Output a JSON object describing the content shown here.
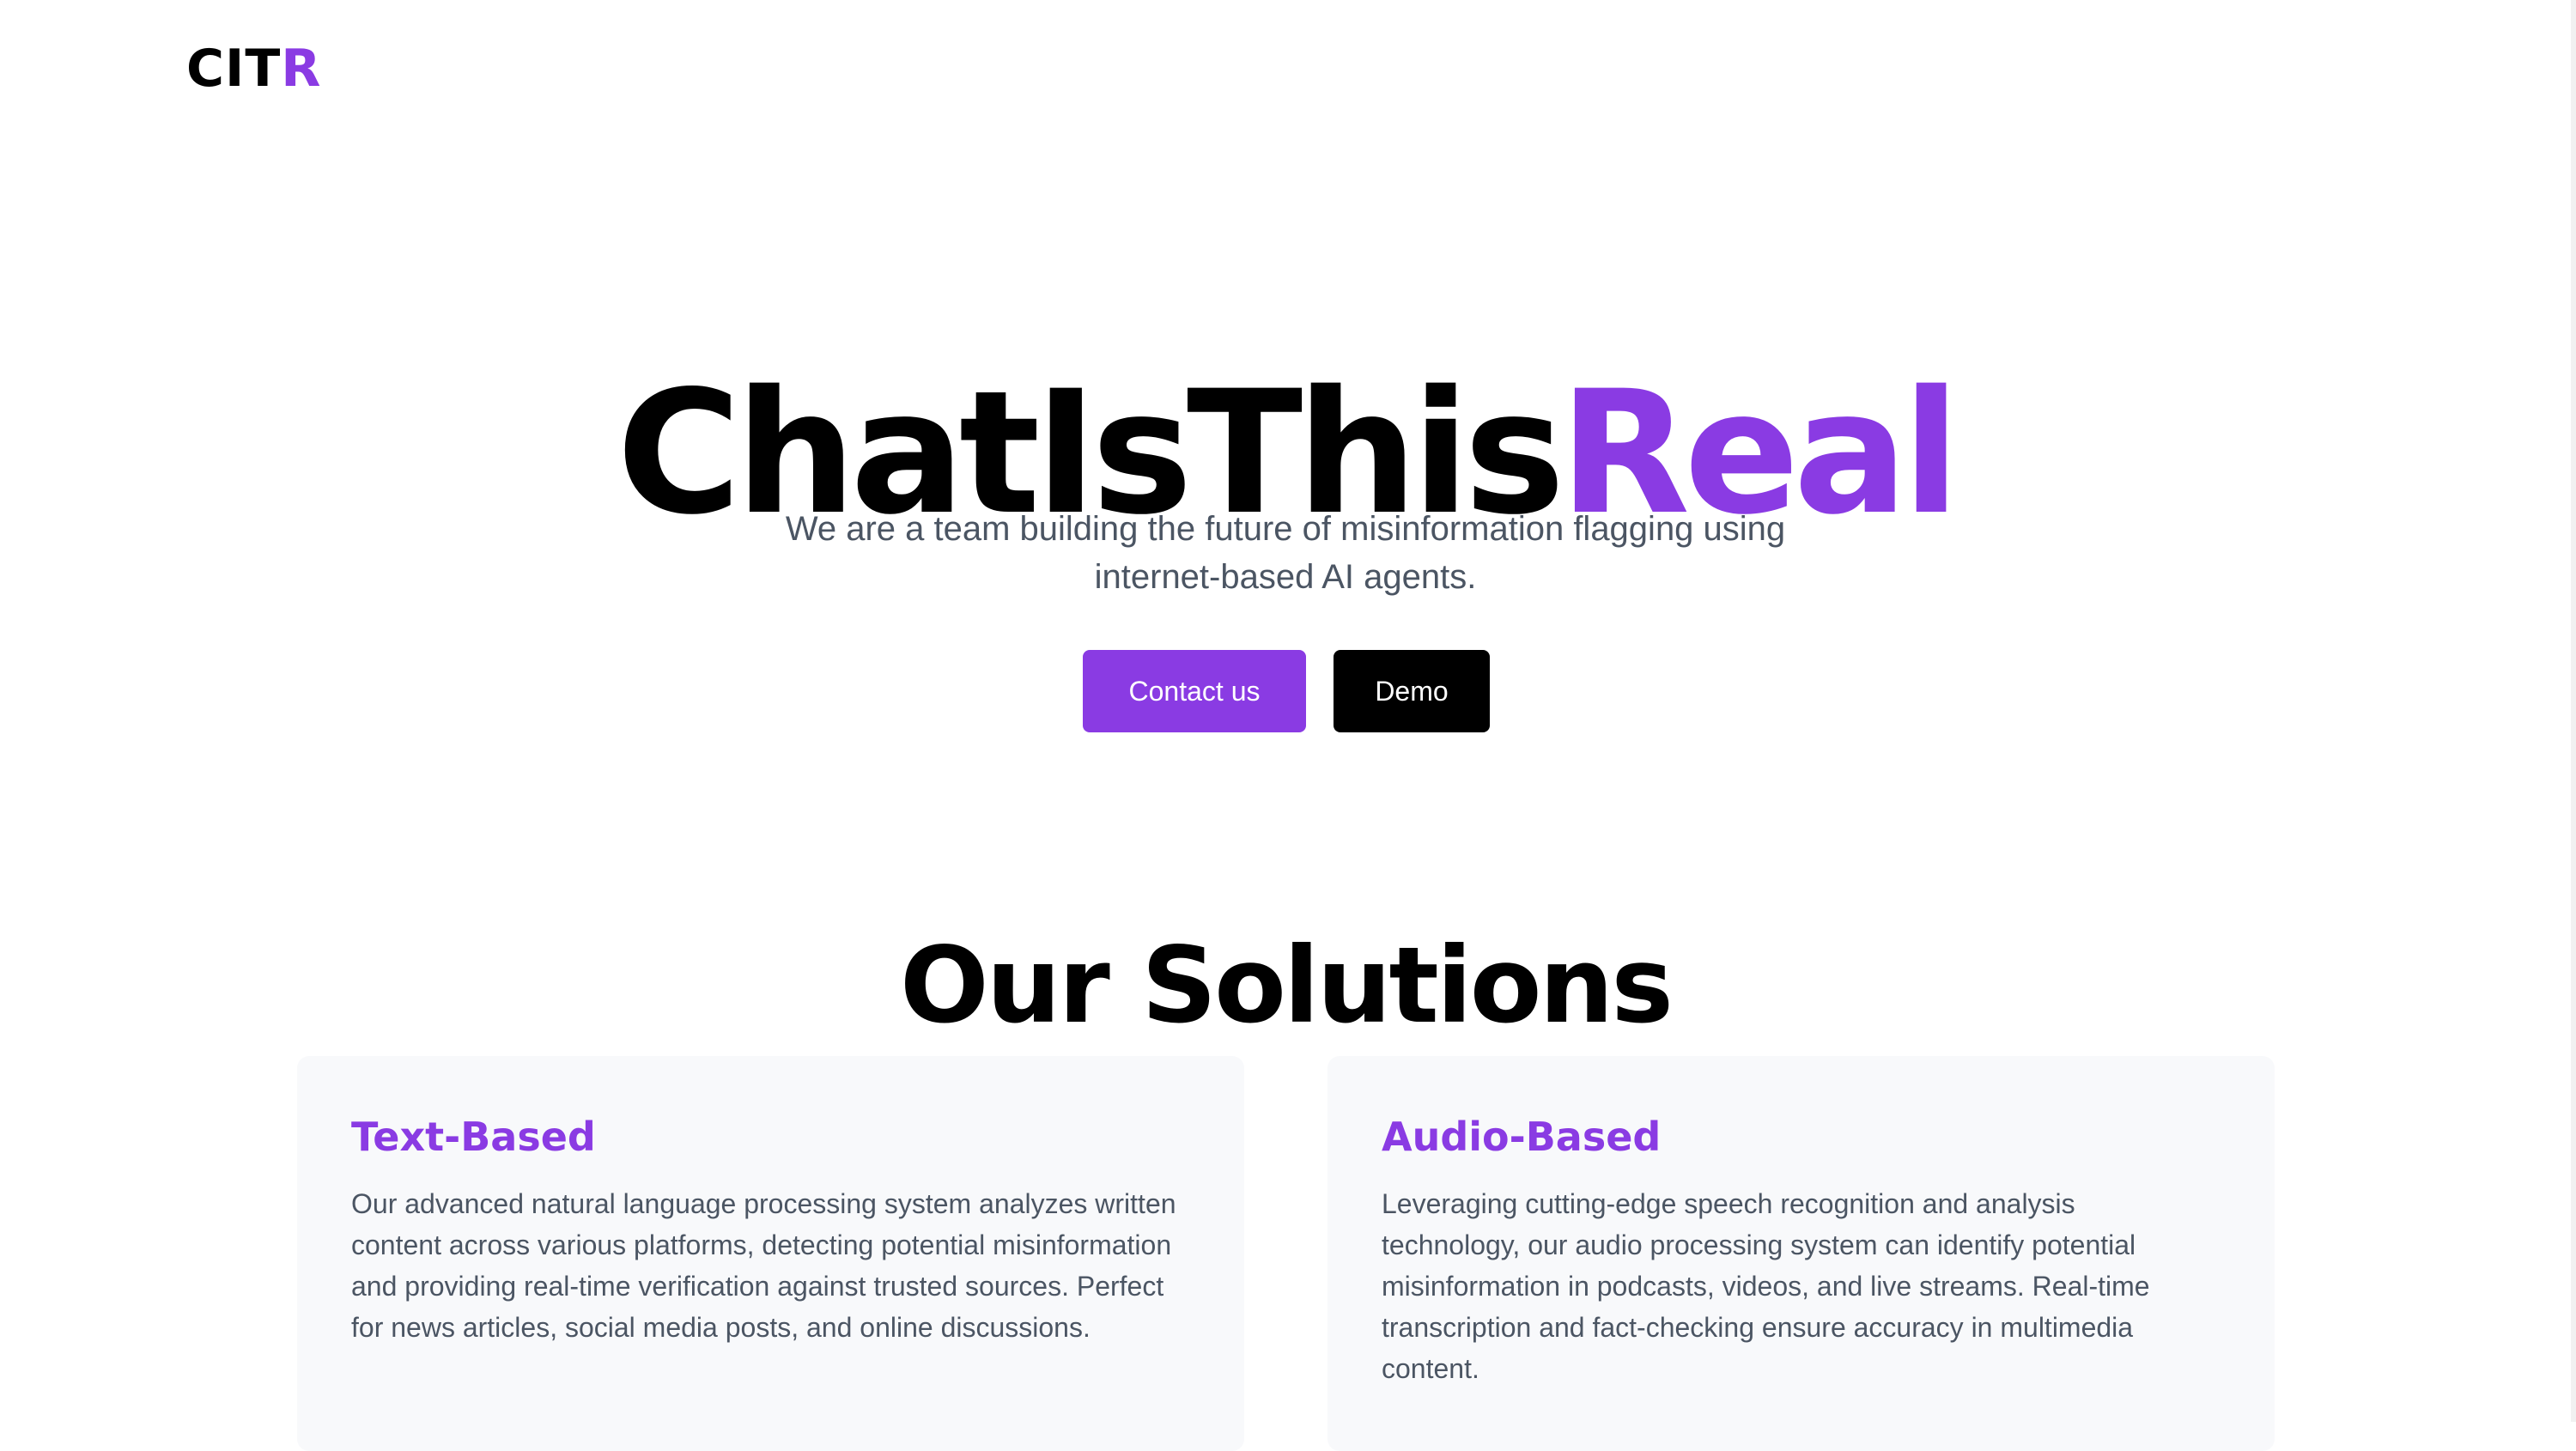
{
  "header": {
    "logo_main": "CIT",
    "logo_accent": "R"
  },
  "hero": {
    "title_main": "ChatIsThis",
    "title_accent": "Real",
    "subtitle": "We are a team building the future of misinformation flagging using internet-based AI agents."
  },
  "actions": {
    "contact_label": "Contact us",
    "demo_label": "Demo"
  },
  "solutions": {
    "title": "Our Solutions",
    "cards": [
      {
        "title": "Text-Based",
        "description": "Our advanced natural language processing system analyzes written content across various platforms, detecting potential misinformation and providing real-time verification against trusted sources. Perfect for news articles, social media posts, and online discussions."
      },
      {
        "title": "Audio-Based",
        "description": "Leveraging cutting-edge speech recognition and analysis technology, our audio processing system can identify potential misinformation in podcasts, videos, and live streams. Real-time transcription and fact-checking ensure accuracy in multimedia content."
      }
    ]
  },
  "colors": {
    "accent": "#8a3be3",
    "text_primary": "#000000",
    "text_secondary": "#4b5563",
    "card_background": "#f8f9fb",
    "button_dark": "#000000"
  }
}
